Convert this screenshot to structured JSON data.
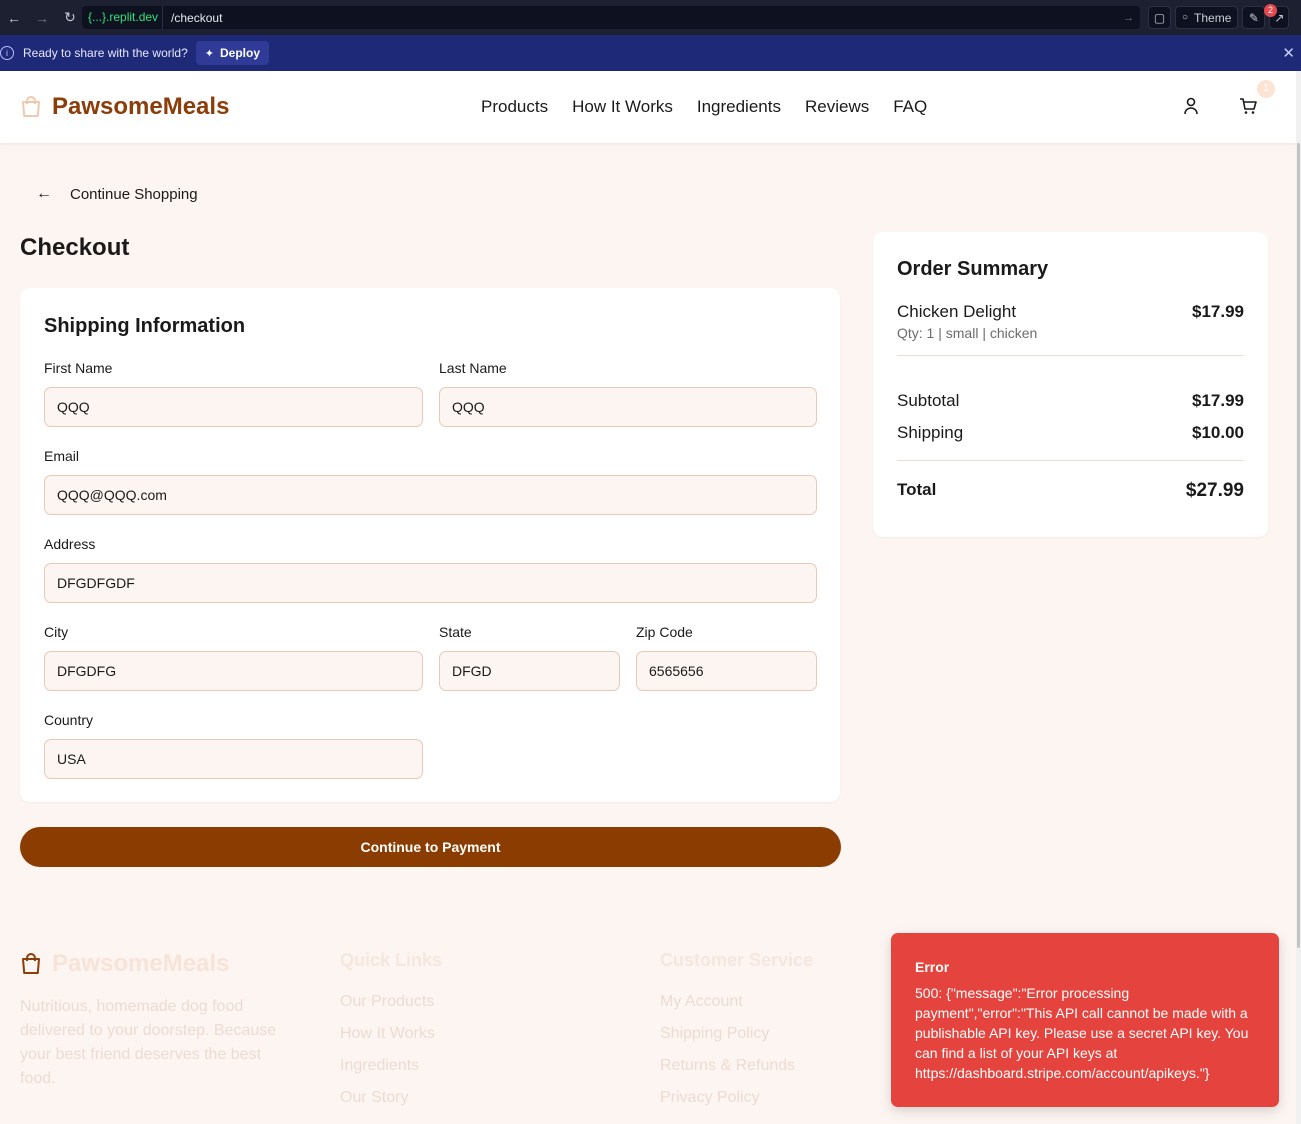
{
  "browser": {
    "host": "{...}.replit.dev",
    "path": "/checkout",
    "theme_label": "Theme",
    "notif_count": "2"
  },
  "deploy_bar": {
    "message": "Ready to share with the world?",
    "deploy_label": "Deploy"
  },
  "header": {
    "logo": "PawsomeMeals",
    "nav": [
      "Products",
      "How It Works",
      "Ingredients",
      "Reviews",
      "FAQ"
    ],
    "cart_count": "1"
  },
  "back_link": "Continue Shopping",
  "page_title": "Checkout",
  "shipping": {
    "title": "Shipping Information",
    "first_name": {
      "label": "First Name",
      "value": "QQQ"
    },
    "last_name": {
      "label": "Last Name",
      "value": "QQQ"
    },
    "email": {
      "label": "Email",
      "value": "QQQ@QQQ.com"
    },
    "address": {
      "label": "Address",
      "value": "DFGDFGDF"
    },
    "city": {
      "label": "City",
      "value": "DFGDFG"
    },
    "state": {
      "label": "State",
      "value": "DFGD"
    },
    "zip": {
      "label": "Zip Code",
      "value": "6565656"
    },
    "country": {
      "label": "Country",
      "value": "USA"
    }
  },
  "pay_button": "Continue to Payment",
  "summary": {
    "title": "Order Summary",
    "item_name": "Chicken Delight",
    "item_price": "$17.99",
    "item_details": "Qty: 1 | small | chicken",
    "subtotal_label": "Subtotal",
    "subtotal": "$17.99",
    "shipping_label": "Shipping",
    "shipping": "$10.00",
    "total_label": "Total",
    "total": "$27.99"
  },
  "footer": {
    "logo": "PawsomeMeals",
    "description": "Nutritious, homemade dog food delivered to your doorstep. Because your best friend deserves the best food.",
    "quick_links_title": "Quick Links",
    "quick_links": [
      "Our Products",
      "How It Works",
      "Ingredients",
      "Our Story"
    ],
    "service_title": "Customer Service",
    "service_links": [
      "My Account",
      "Shipping Policy",
      "Returns & Refunds",
      "Privacy Policy"
    ]
  },
  "toast": {
    "title": "Error",
    "message": "500: {\"message\":\"Error processing payment\",\"error\":\"This API call cannot be made with a publishable API key. Please use a secret API key. You can find a list of your API keys at https://dashboard.stripe.com/account/apikeys.\"}"
  },
  "colors": {
    "brand": "#8b3d0a",
    "button": "#8b3c00",
    "page_bg": "#fdf5f1",
    "toast_bg": "#e5433d"
  }
}
